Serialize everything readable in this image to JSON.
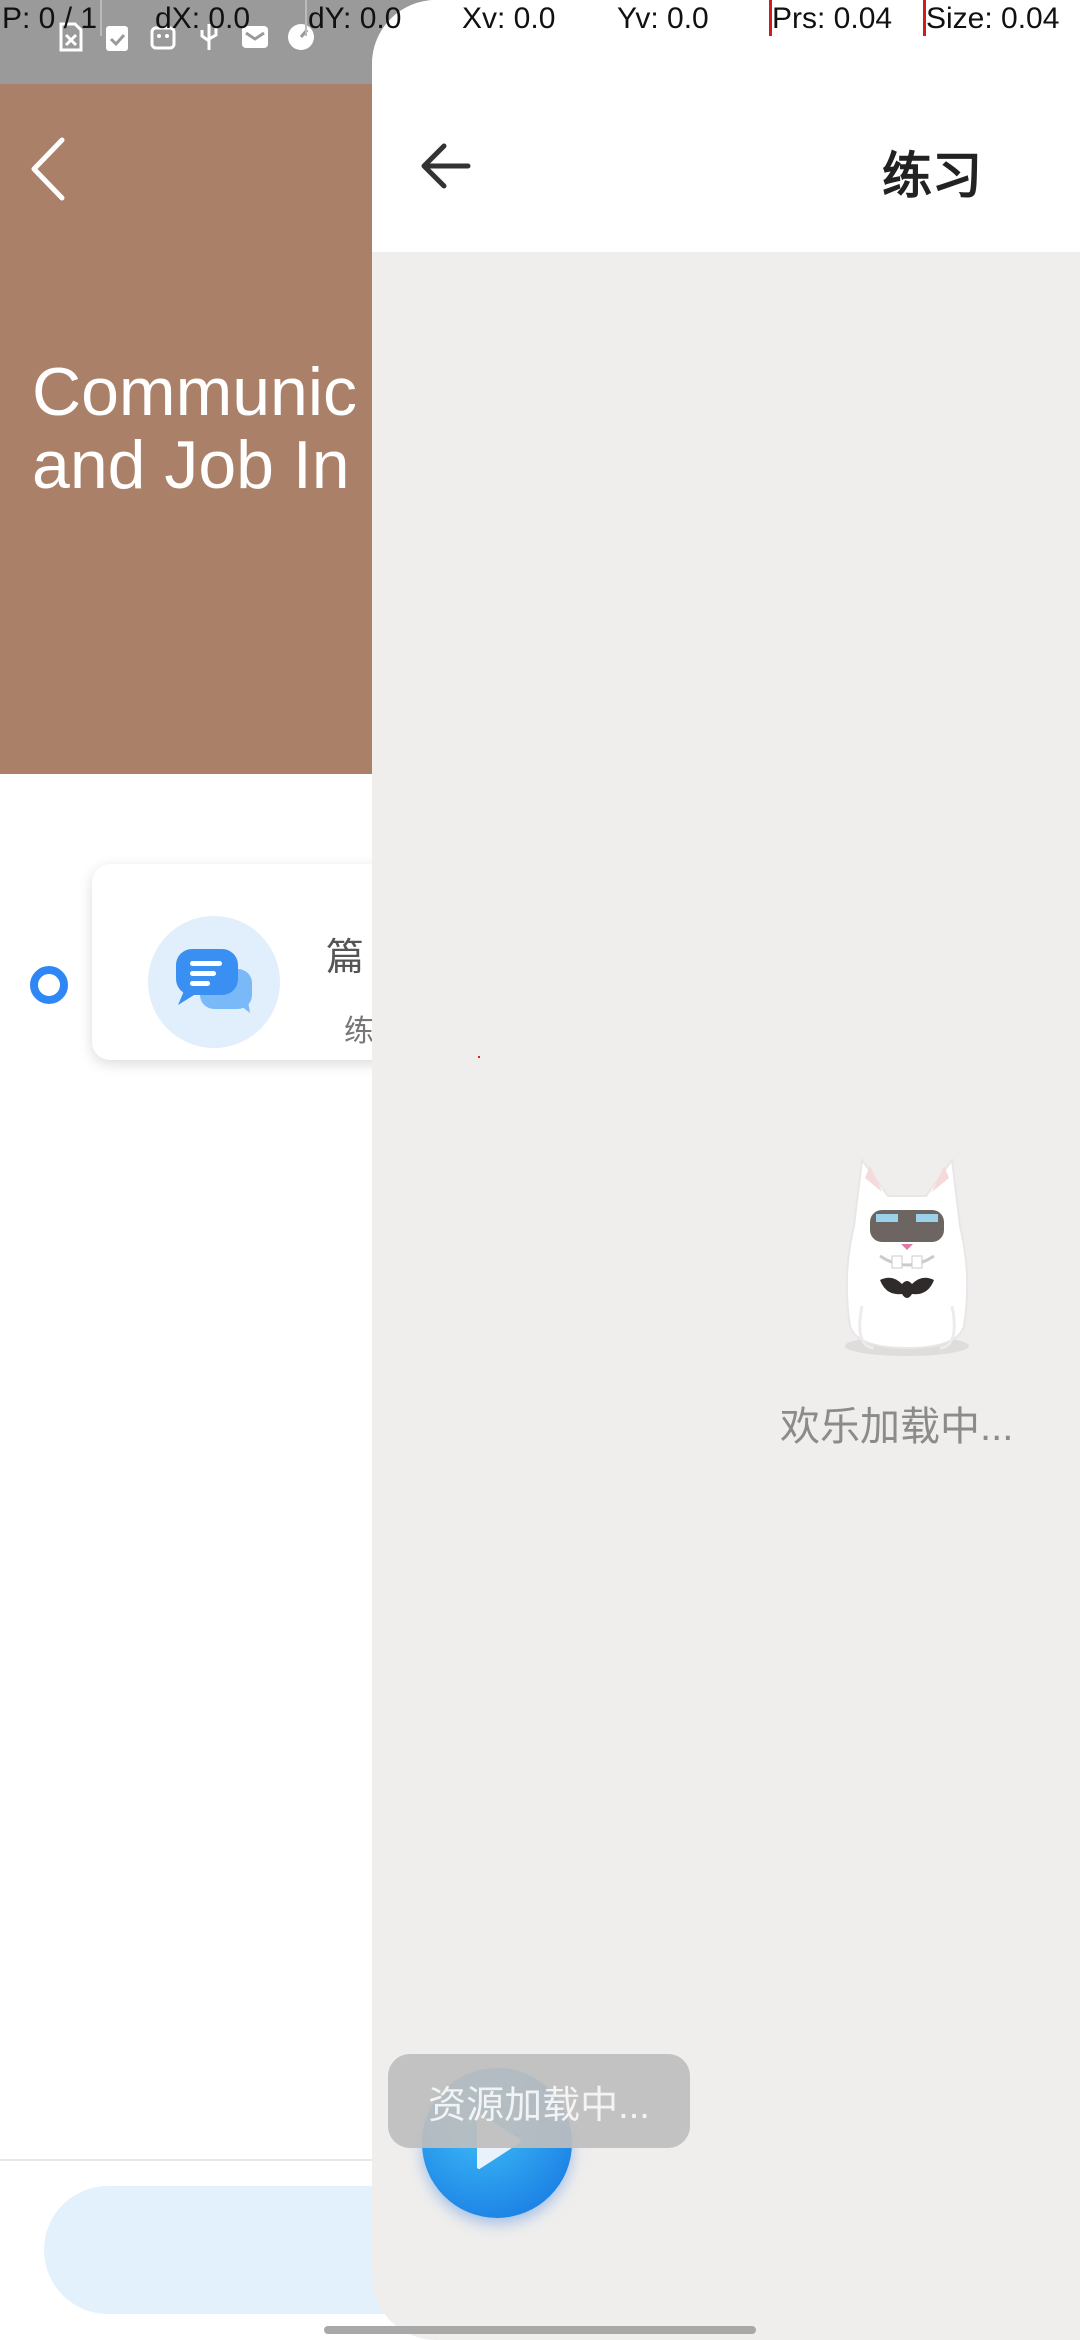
{
  "debug_bar": {
    "p": "P: 0 / 1",
    "dx": "dX: 0.0",
    "dy": "dY: 0.0",
    "xv": "Xv: 0.0",
    "yv": "Yv: 0.0",
    "prs": "Prs: 0.04",
    "size": "Size: 0.04"
  },
  "status_icons": [
    "sim-card-off-icon",
    "clipboard-check-icon",
    "usb-debug-icon",
    "usb-icon",
    "mail-icon",
    "speedometer-icon"
  ],
  "background_page": {
    "hero_title": "Communic\nand Job In",
    "hero_color": "#ab8068",
    "card": {
      "title": "篇",
      "subtitle": "练"
    },
    "accent_color": "#2f86f5"
  },
  "panel": {
    "title": "练习",
    "loading_text": "欢乐加载中...",
    "toast_text": "资源加载中..."
  }
}
